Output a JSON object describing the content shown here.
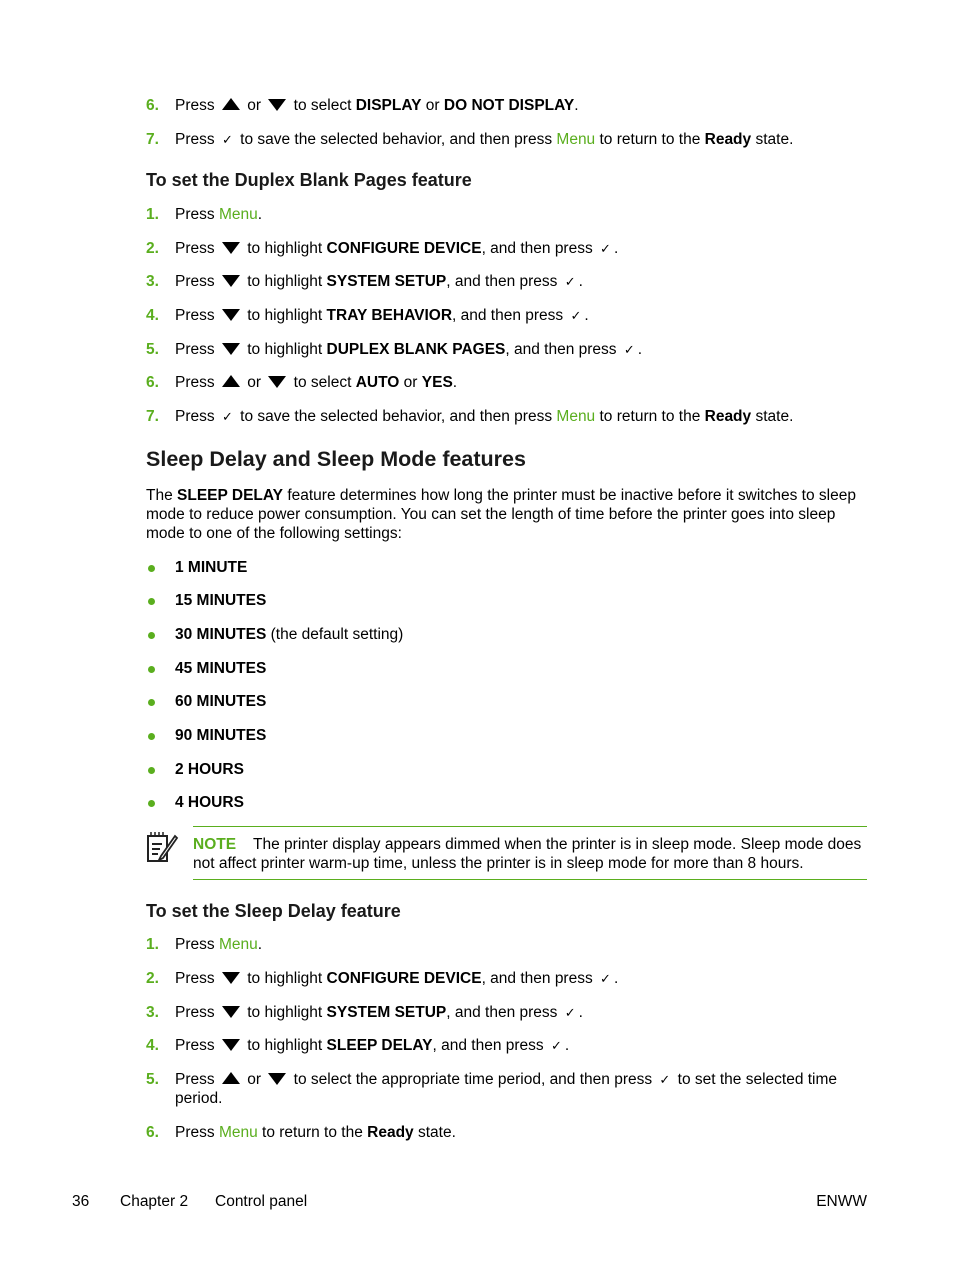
{
  "top_steps": [
    {
      "num": "6.",
      "parts": [
        "Press",
        "up",
        "or",
        "down",
        "to select",
        "DISPLAY",
        "or",
        "DO NOT DISPLAY",
        "."
      ]
    },
    {
      "num": "7.",
      "pre": "Press",
      "mid": "to save the selected behavior, and then press",
      "link": "Menu",
      "post": "to return to the",
      "bold": "Ready",
      "end": "state."
    }
  ],
  "duplex_section": {
    "heading": "To set the Duplex Blank Pages feature",
    "steps": [
      {
        "num": "1.",
        "pre": "Press",
        "link": "Menu",
        "end": "."
      },
      {
        "num": "2.",
        "pre": "Press",
        "mid": "to highlight",
        "bold": "CONFIGURE DEVICE",
        "post": ", and then press"
      },
      {
        "num": "3.",
        "pre": "Press",
        "mid": "to highlight",
        "bold": "SYSTEM SETUP",
        "post": ", and then press"
      },
      {
        "num": "4.",
        "pre": "Press",
        "mid": "to highlight",
        "bold": "TRAY BEHAVIOR",
        "post": ", and then press"
      },
      {
        "num": "5.",
        "pre": "Press",
        "mid": "to highlight",
        "bold": "DUPLEX BLANK PAGES",
        "post": ", and then press"
      },
      {
        "num": "6.",
        "pre": "Press",
        "or": "or",
        "mid": "to select",
        "bold1": "AUTO",
        "or2": "or",
        "bold2": "YES",
        "end": "."
      },
      {
        "num": "7.",
        "pre": "Press",
        "mid": "to save the selected behavior, and then press",
        "link": "Menu",
        "post": "to return to the",
        "bold": "Ready",
        "end": "state."
      }
    ]
  },
  "sleep_section": {
    "heading": "Sleep Delay and Sleep Mode features",
    "intro_pre": "The",
    "intro_bold": "SLEEP DELAY",
    "intro_post": "feature determines how long the printer must be inactive before it switches to sleep mode to reduce power consumption. You can set the length of time before the printer goes into sleep mode to one of the following settings:",
    "options": [
      {
        "label": "1 MINUTE",
        "note": ""
      },
      {
        "label": "15 MINUTES",
        "note": ""
      },
      {
        "label": "30 MINUTES",
        "note": "(the default setting)"
      },
      {
        "label": "45 MINUTES",
        "note": ""
      },
      {
        "label": "60 MINUTES",
        "note": ""
      },
      {
        "label": "90 MINUTES",
        "note": ""
      },
      {
        "label": "2 HOURS",
        "note": ""
      },
      {
        "label": "4 HOURS",
        "note": ""
      }
    ],
    "note_label": "NOTE",
    "note_text": "The printer display appears dimmed when the printer is in sleep mode. Sleep mode does not affect printer warm-up time, unless the printer is in sleep mode for more than 8 hours."
  },
  "sleep_delay_section": {
    "heading": "To set the Sleep Delay feature",
    "steps": [
      {
        "num": "1.",
        "pre": "Press",
        "link": "Menu",
        "end": "."
      },
      {
        "num": "2.",
        "pre": "Press",
        "mid": "to highlight",
        "bold": "CONFIGURE DEVICE",
        "post": ", and then press"
      },
      {
        "num": "3.",
        "pre": "Press",
        "mid": "to highlight",
        "bold": "SYSTEM SETUP",
        "post": ", and then press"
      },
      {
        "num": "4.",
        "pre": "Press",
        "mid": "to highlight",
        "bold": "SLEEP DELAY",
        "post": ", and then press"
      },
      {
        "num": "5.",
        "pre": "Press",
        "or": "or",
        "mid": "to select the appropriate time period, and then press",
        "post": "to set the selected time period."
      },
      {
        "num": "6.",
        "pre": "Press",
        "link": "Menu",
        "post": "to return to the",
        "bold": "Ready",
        "end": "state."
      }
    ]
  },
  "top_step6": {
    "pre": "Press",
    "or": "or",
    "mid": "to select",
    "bold1": "DISPLAY",
    "or2": "or",
    "bold2": "DO NOT DISPLAY",
    "end": "."
  },
  "footer": {
    "page": "36",
    "chapter": "Chapter 2",
    "section": "Control panel",
    "right": "ENWW"
  },
  "icons": {
    "up": "up-arrow-icon",
    "down": "down-arrow-icon",
    "check": "checkmark-icon",
    "note": "note-pencil-icon"
  },
  "glyphs": {
    "check": "✓"
  },
  "colors": {
    "accent": "#5aae1e"
  }
}
